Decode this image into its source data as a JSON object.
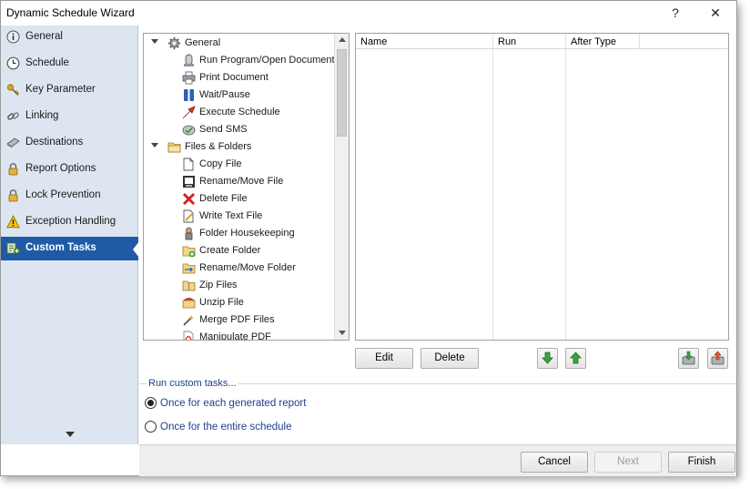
{
  "window": {
    "title": "Dynamic Schedule Wizard",
    "help_glyph": "?",
    "close_glyph": "✕"
  },
  "sidebar": {
    "items": [
      {
        "label": "General",
        "icon": "info-icon"
      },
      {
        "label": "Schedule",
        "icon": "clock-icon"
      },
      {
        "label": "Key Parameter",
        "icon": "key-icon"
      },
      {
        "label": "Linking",
        "icon": "chain-link-icon"
      },
      {
        "label": "Destinations",
        "icon": "destinations-icon"
      },
      {
        "label": "Report Options",
        "icon": "lock-icon"
      },
      {
        "label": "Lock Prevention",
        "icon": "lock-icon"
      },
      {
        "label": "Exception Handling",
        "icon": "warning-icon"
      },
      {
        "label": "Custom Tasks",
        "icon": "tasks-icon",
        "active": true
      }
    ]
  },
  "tree": {
    "groups": [
      {
        "label": "General",
        "icon": "gear-icon",
        "items": [
          {
            "label": "Run Program/Open Document",
            "icon": "run-program-icon"
          },
          {
            "label": "Print Document",
            "icon": "printer-icon"
          },
          {
            "label": "Wait/Pause",
            "icon": "pause-icon"
          },
          {
            "label": "Execute Schedule",
            "icon": "execute-arrow-icon"
          },
          {
            "label": "Send SMS",
            "icon": "sms-icon"
          }
        ]
      },
      {
        "label": "Files & Folders",
        "icon": "folder-icon",
        "items": [
          {
            "label": "Copy File",
            "icon": "copy-file-icon"
          },
          {
            "label": "Rename/Move File",
            "icon": "rename-file-icon"
          },
          {
            "label": "Delete File",
            "icon": "delete-x-icon"
          },
          {
            "label": "Write Text File",
            "icon": "write-text-icon"
          },
          {
            "label": "Folder Housekeeping",
            "icon": "housekeeping-icon"
          },
          {
            "label": "Create Folder",
            "icon": "create-folder-icon"
          },
          {
            "label": "Rename/Move Folder",
            "icon": "rename-folder-icon"
          },
          {
            "label": "Zip Files",
            "icon": "zip-icon"
          },
          {
            "label": "Unzip File",
            "icon": "unzip-icon"
          },
          {
            "label": "Merge PDF Files",
            "icon": "merge-pdf-icon"
          },
          {
            "label": "Manipulate PDF",
            "icon": "pdf-icon"
          }
        ]
      }
    ]
  },
  "grid": {
    "columns": [
      "Name",
      "Run",
      "After Type"
    ]
  },
  "actions": {
    "edit_label": "Edit",
    "delete_label": "Delete"
  },
  "run_options": {
    "legend": "Run custom tasks...",
    "options": [
      "Once for each generated report",
      "Once for the entire schedule"
    ],
    "selected_index": 0
  },
  "footer": {
    "cancel_label": "Cancel",
    "next_label": "Next",
    "finish_label": "Finish"
  },
  "colors": {
    "accent": "#1f5aa6",
    "sidebar_bg": "#dde6f0",
    "link_text": "#1e3f8a"
  }
}
